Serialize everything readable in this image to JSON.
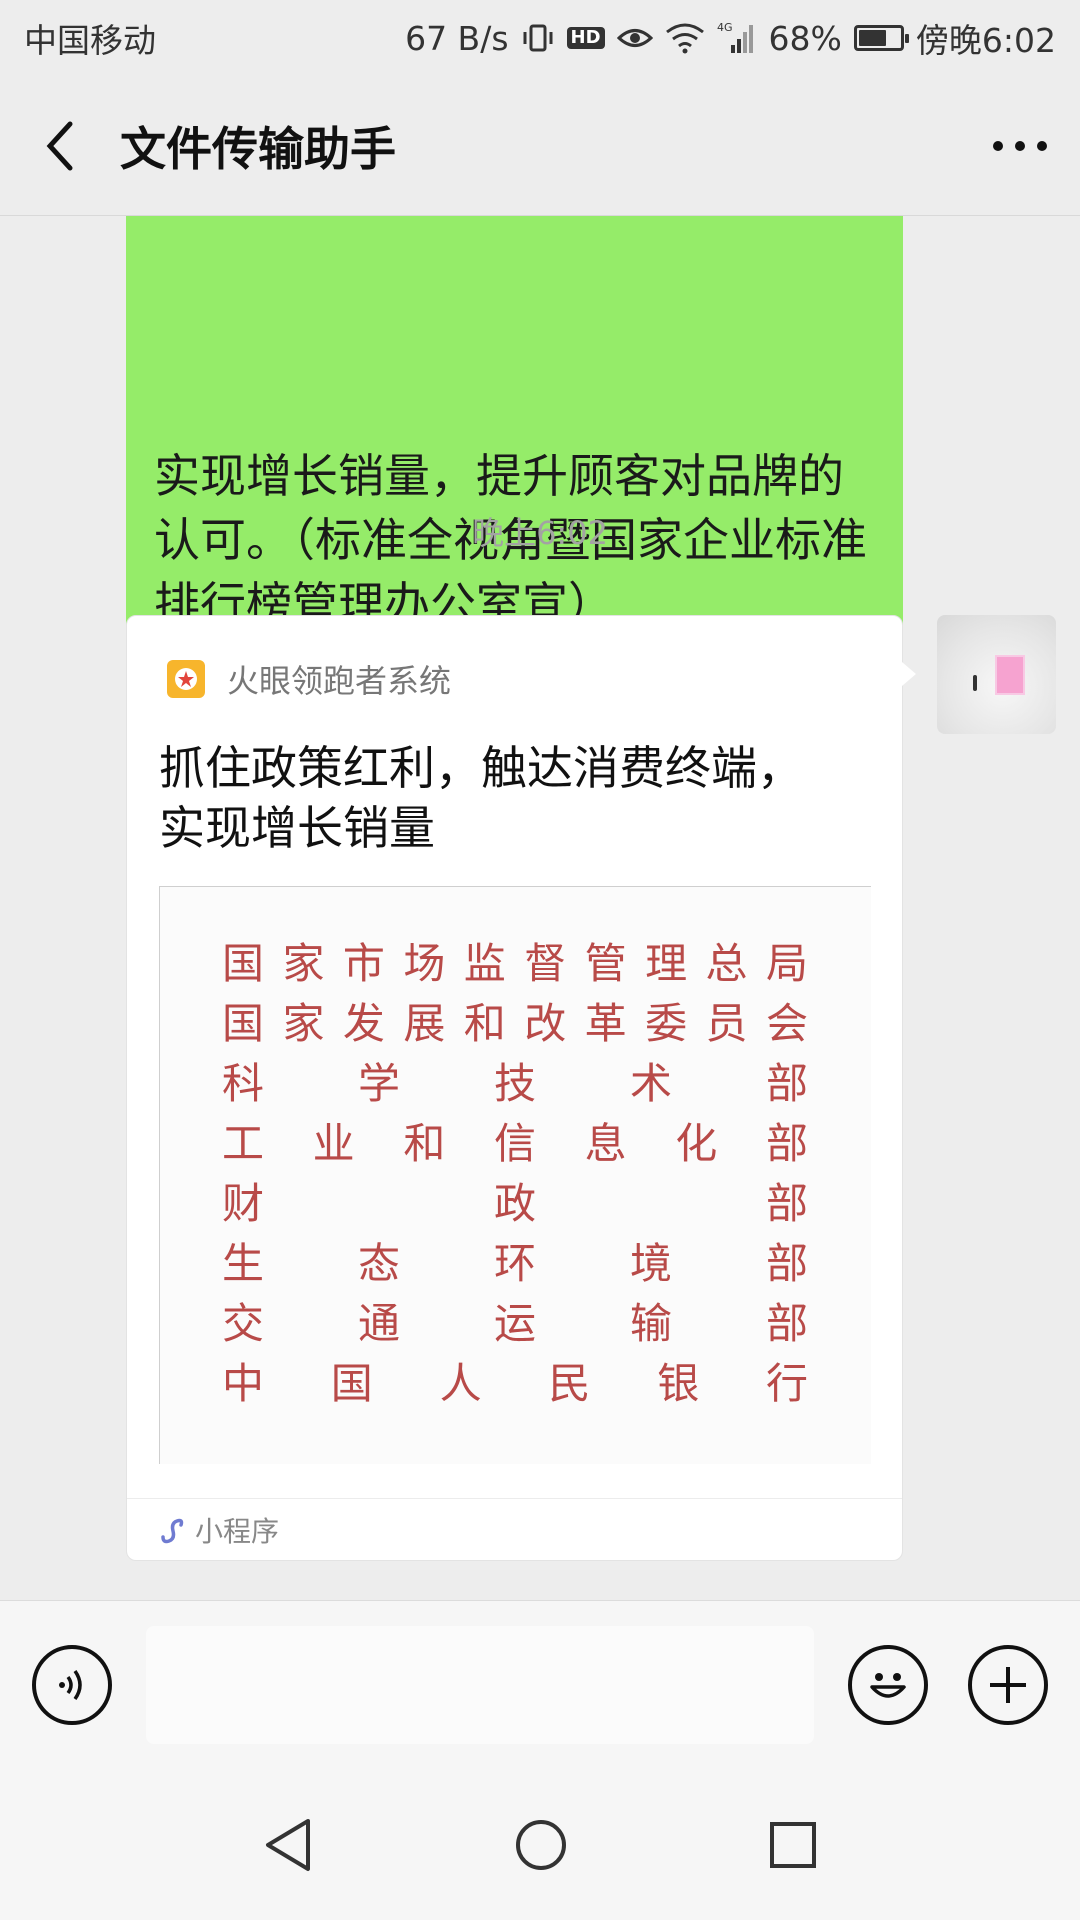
{
  "status_bar": {
    "carrier": "中国移动",
    "speed": "67 B/s",
    "hd": "HD",
    "network": "4G",
    "battery_level": 68,
    "battery": "68%",
    "time": "傍晚6:02"
  },
  "header": {
    "title": "文件传输助手",
    "back_icon": "back-chevron-icon",
    "more_icon": "more-dots-icon"
  },
  "messages": {
    "text_bubble": {
      "text": "实现增长销量，提升顾客对品牌的认可。（标准全视角暨国家企业标准排行榜管理办公室宣）",
      "color": "#95ec69"
    },
    "timestamp": "晚上6:02",
    "card": {
      "source": "火眼领跑者系统",
      "title": "抓住政策红利，触达消费终端，实现增长销量",
      "image_agencies": [
        "国家市场监督管理总局",
        "国家发展和改革委员会",
        "科学技术部",
        "工业和信息化部",
        "财政部",
        "生态环境部",
        "交通运输部",
        "中国人民银行"
      ],
      "footer_label": "小程序"
    }
  },
  "input_bar": {
    "voice_icon": "voice-icon",
    "emoji_icon": "emoji-icon",
    "plus_icon": "plus-icon"
  },
  "android_nav": {
    "back": "nav-back-triangle-icon",
    "home": "nav-home-circle-icon",
    "recents": "nav-recents-square-icon"
  }
}
